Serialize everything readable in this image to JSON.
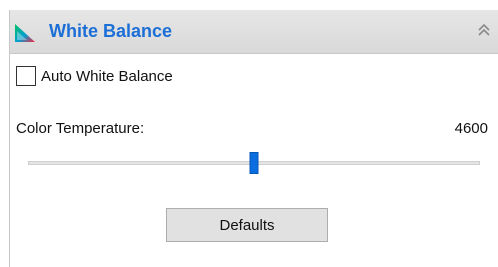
{
  "panel": {
    "title": "White Balance",
    "title_color": "#1c6fd6",
    "header_icon": "color-gamut-icon",
    "collapse_icon": "double-chevron-up-icon"
  },
  "auto_white_balance": {
    "label": "Auto White Balance",
    "checked": false
  },
  "color_temperature": {
    "label": "Color Temperature:",
    "value": "4600",
    "slider_fraction": 0.5,
    "thumb_color": "#0a6ee0"
  },
  "defaults_button": {
    "label": "Defaults"
  }
}
